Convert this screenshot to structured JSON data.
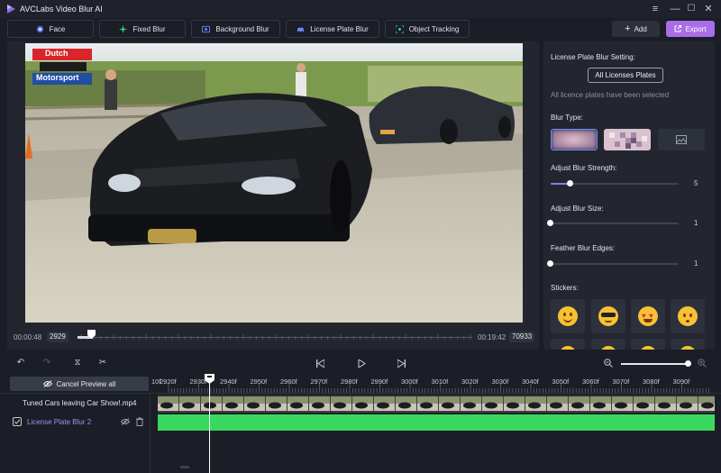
{
  "app": {
    "title": "AVCLabs Video Blur AI"
  },
  "window_controls": {
    "menu": "≡",
    "minimize": "—",
    "maximize": "☐",
    "close": "✕"
  },
  "modes": [
    {
      "label": "Face",
      "icon": "face-icon"
    },
    {
      "label": "Fixed Blur",
      "icon": "fixed-blur-icon"
    },
    {
      "label": "Background Blur",
      "icon": "background-blur-icon"
    },
    {
      "label": "License Plate Blur",
      "icon": "car-icon"
    },
    {
      "label": "Object Tracking",
      "icon": "tracking-icon"
    }
  ],
  "toolbar": {
    "add_label": "Add",
    "export_label": "Export"
  },
  "video": {
    "watermark_top": "Dutch",
    "watermark_bottom": "Motorsport",
    "time_current": "00:00:48",
    "frame_current": "2929",
    "time_total": "00:19:42",
    "frame_total": "70933"
  },
  "settings": {
    "heading": "License Plate Blur Setting:",
    "all_plates_button": "All Licenses Plates",
    "selected_note": "All licence plates have been selected",
    "blur_type_label": "Blur Type:",
    "blur_types": [
      "gaussian-blur-icon",
      "mosaic-blur-icon",
      "image-sticker-icon"
    ],
    "strength_label": "Adjust Blur Strength:",
    "strength_value": "5",
    "strength_fraction": 0.15,
    "size_label": "Adjust Blur Size:",
    "size_value": "1",
    "feather_label": "Feather Blur Edges:",
    "feather_value": "1",
    "stickers_label": "Stickers:",
    "stickers": [
      "smiley-icon",
      "sunglasses-icon",
      "heart-eyes-icon",
      "neutral-face-icon"
    ]
  },
  "timeline": {
    "cancel_preview": "Cancel Preview all",
    "clip_name": "Tuned Cars leaving Car Show!.mp4",
    "blur_track": "License Plate Blur 2",
    "ticks": [
      "10f",
      "2920f",
      "2930f",
      "2940f",
      "2950f",
      "2960f",
      "2970f",
      "2980f",
      "2990f",
      "3000f",
      "3010f",
      "3020f",
      "3030f",
      "3040f",
      "3050f",
      "3060f",
      "3070f",
      "3080f",
      "3090f"
    ],
    "zoom_fraction": 0.98
  },
  "colors": {
    "accent": "#a96de8",
    "track_green": "#3ad85f",
    "blur_track_text": "#a98cf5"
  }
}
